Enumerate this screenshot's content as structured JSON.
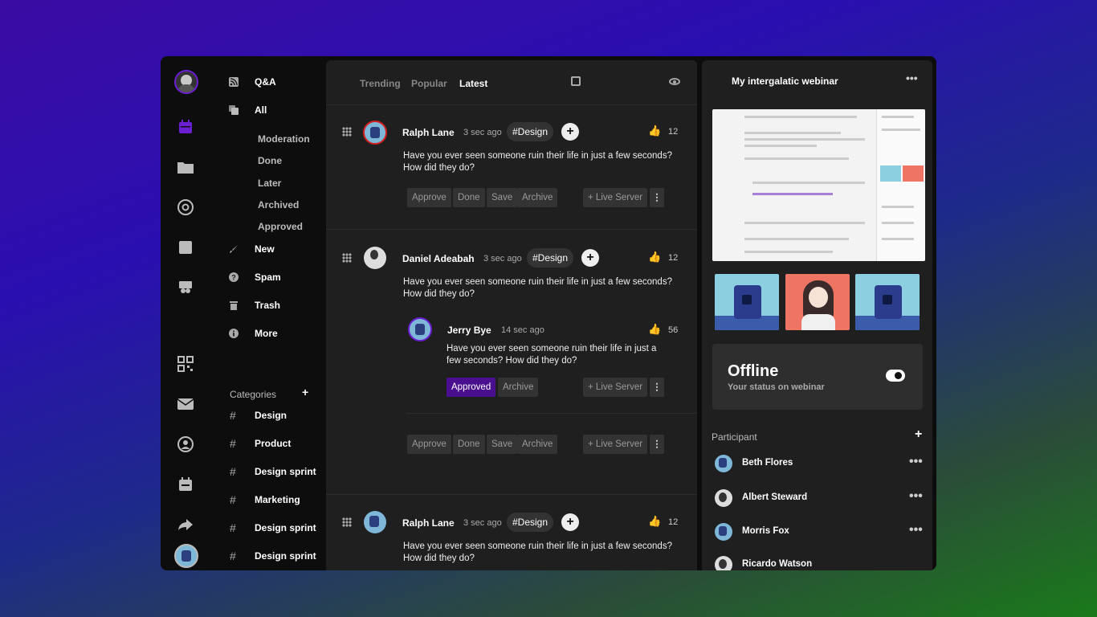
{
  "feed": {
    "tabs": [
      "Trending",
      "Popular",
      "Latest"
    ],
    "active_tab": "Latest",
    "posts": [
      {
        "author": "Ralph Lane",
        "time": "3 sec ago",
        "tag": "#Design",
        "likes": "12",
        "text_1": "Have you ever seen someone ruin their life in just a few seconds?",
        "text_2": "How did they do?",
        "actions": [
          "Approve",
          "Done",
          "Save",
          "Archive"
        ],
        "live": "Live Server"
      },
      {
        "author": "Daniel Adeabah",
        "time": "3 sec ago",
        "tag": "#Design",
        "likes": "12",
        "text_1": "Have you ever seen someone ruin their life in just a few seconds?",
        "text_2": "How did they do?",
        "reply": {
          "author": "Jerry Bye",
          "time": "14 sec ago",
          "likes": "56",
          "text_1": "Have you ever seen someone ruin their life in just a",
          "text_2": "few seconds? How did they do?",
          "actions": [
            "Approved",
            "Archive"
          ],
          "live": "Live Server"
        },
        "actions": [
          "Approve",
          "Done",
          "Save",
          "Archive"
        ],
        "live": "Live Server"
      },
      {
        "author": "Ralph Lane",
        "time": "3 sec ago",
        "tag": "#Design",
        "likes": "12",
        "text_1": "Have you ever seen someone ruin their life in just a few seconds?",
        "text_2": "How did they do?"
      }
    ]
  },
  "nav": {
    "main": [
      {
        "label": "Q&A",
        "icon": "rss-icon"
      },
      {
        "label": "All",
        "icon": "copy-icon"
      }
    ],
    "sub": [
      "Moderation",
      "Done",
      "Later",
      "Archived",
      "Approved"
    ],
    "more": [
      {
        "label": "New",
        "icon": "brush-icon"
      },
      {
        "label": "Spam",
        "icon": "question-icon"
      },
      {
        "label": "Trash",
        "icon": "trash-icon"
      },
      {
        "label": "More",
        "icon": "info-icon"
      }
    ],
    "categories_title": "Categories",
    "categories": [
      "Design",
      "Product",
      "Design sprint",
      "Marketing",
      "Design sprint",
      "Design sprint"
    ]
  },
  "right": {
    "title": "My intergalatic webinar",
    "status": "Offline",
    "status_sub": "Your status on webinar",
    "participant_title": "Participant",
    "participants": [
      "Beth Flores",
      "Albert Steward",
      "Morris Fox",
      "Ricardo Watson"
    ]
  },
  "colors": {
    "accent": "#4a0f8f",
    "ring_purple": "#6a1fd1",
    "ring_red": "#d32020"
  }
}
